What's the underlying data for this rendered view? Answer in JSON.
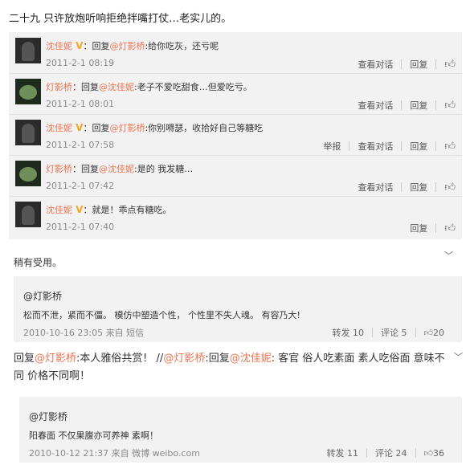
{
  "title": "二十九 只许放炮听响拒绝拌嘴打仗…老实儿的。",
  "conversation": [
    {
      "user": "沈佳妮",
      "verified": true,
      "reply_prefix": "：回复",
      "target": "@灯影桥",
      "text": ":给你吃灰，还亏呢",
      "time": "2011-2-1 08:19",
      "actions": [
        "查看对话",
        "回复"
      ],
      "avatar": "dark"
    },
    {
      "user": "灯影桥",
      "verified": false,
      "reply_prefix": "：回复",
      "target": "@沈佳妮",
      "text": ":老子不爱吃甜食…但爱吃亏。",
      "time": "2011-2-1 08:01",
      "actions": [
        "查看对话",
        "回复"
      ],
      "avatar": "cat"
    },
    {
      "user": "沈佳妮",
      "verified": true,
      "reply_prefix": "：回复",
      "target": "@灯影桥",
      "text": ":你别嘚瑟，收拾好自己等糖吃",
      "time": "2011-2-1 07:58",
      "actions": [
        "举报",
        "查看对话",
        "回复"
      ],
      "avatar": "dark"
    },
    {
      "user": "灯影桥",
      "verified": false,
      "reply_prefix": "：回复",
      "target": "@沈佳妮",
      "text": ":是的 我发糖…",
      "time": "2011-2-1 07:42",
      "actions": [
        "查看对话",
        "回复"
      ],
      "avatar": "cat"
    },
    {
      "user": "沈佳妮",
      "verified": true,
      "reply_prefix": "：",
      "target": "",
      "text": "就是！乖点有糖吃。",
      "time": "2011-2-1 07:40",
      "actions": [
        "回复"
      ],
      "avatar": "dark"
    }
  ],
  "comment1": {
    "text": "稍有受用。",
    "quote": {
      "user": "@灯影桥",
      "text": "松而不泄，紧而不僵。 模仿中塑造个性， 个性里不失人魂。 有容乃大!",
      "meta": "2010-10-16 23:05 来自 短信",
      "repost": "转发 10",
      "comment": "评论 5",
      "likes": "20"
    }
  },
  "comment2": {
    "parts": [
      {
        "t": "回复",
        "c": "plain"
      },
      {
        "t": "@灯影桥",
        "c": "nm"
      },
      {
        "t": ":本人雅俗共赏！ //",
        "c": "plain"
      },
      {
        "t": "@灯影桥",
        "c": "nm"
      },
      {
        "t": ":回复",
        "c": "plain"
      },
      {
        "t": "@沈佳妮",
        "c": "nm"
      },
      {
        "t": ": 客官 俗人吃素面 素人吃俗面 意味不同 价格不同啊！",
        "c": "plain"
      }
    ],
    "quote": {
      "user": "@灯影桥",
      "text": "阳春面 不仅果腹亦可养神 素啊！",
      "meta": "2010-10-12 21:37 来自 微博 weibo.com",
      "repost": "转发 11",
      "comment": "评论 24",
      "likes": "36"
    }
  },
  "icons": {
    "like": "thumbs-up-icon",
    "chevron": "chevron-down-icon",
    "verified": "verified-v-icon"
  },
  "colors": {
    "username": "#eb7350",
    "background_gray": "#f2f2f2",
    "verified": "#f5a623"
  }
}
